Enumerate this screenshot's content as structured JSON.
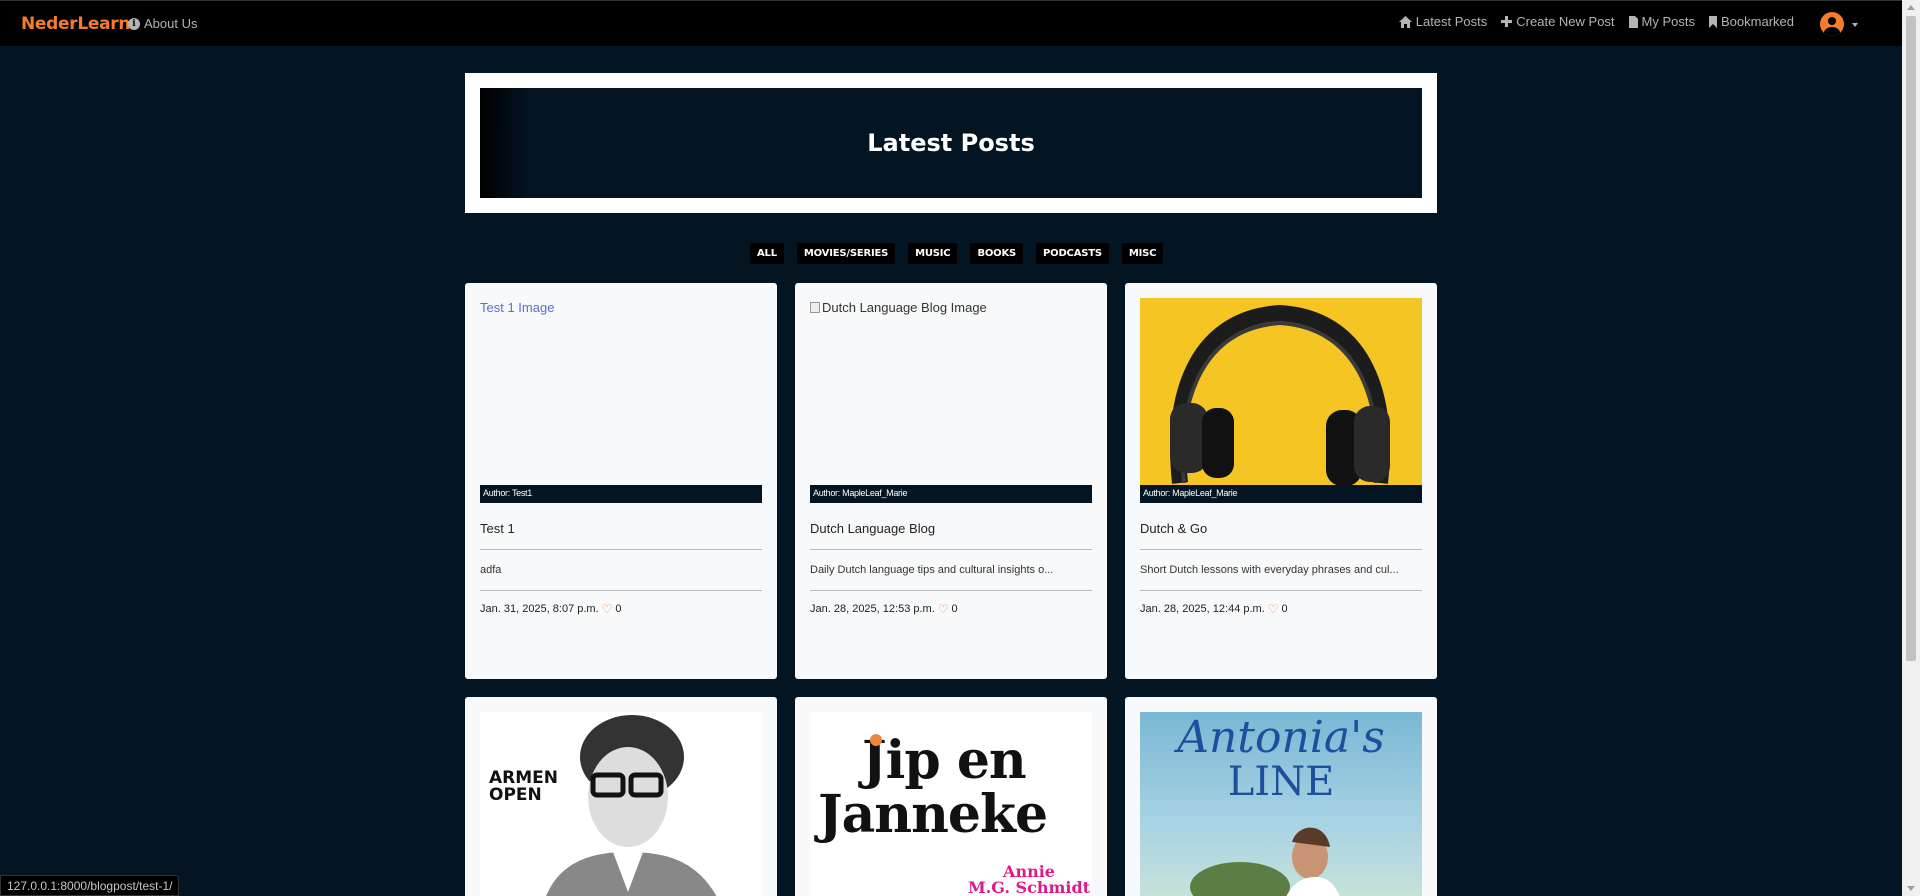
{
  "nav": {
    "brand": "NederLearn",
    "about": "About Us",
    "links": [
      "Latest Posts",
      "Create New Post",
      "My Posts",
      "Bookmarked"
    ]
  },
  "hero": {
    "title": "Latest Posts"
  },
  "filters": [
    "ALL",
    "MOVIES/SERIES",
    "MUSIC",
    "BOOKS",
    "PODCASTS",
    "MISC"
  ],
  "posts": [
    {
      "image_alt": "Test 1 Image",
      "author": "Author: Test1",
      "title": "Test 1",
      "description": "adfa",
      "date": "Jan. 31, 2025, 8:07 p.m.",
      "likes": "0"
    },
    {
      "image_alt": "Dutch Language Blog Image",
      "author": "Author: MapleLeaf_Marie",
      "title": "Dutch Language Blog",
      "description": "Daily Dutch language tips and cultural insights o...",
      "date": "Jan. 28, 2025, 12:53 p.m.",
      "likes": "0"
    },
    {
      "image_alt": "",
      "author": "Author: MapleLeaf_Marie",
      "title": "Dutch & Go",
      "description": "Short Dutch lessons with everyday phrases and cul...",
      "date": "Jan. 28, 2025, 12:44 p.m.",
      "likes": "0"
    }
  ],
  "row2": {
    "armen": [
      "ARMEN",
      "OPEN"
    ],
    "jip": [
      "Jip en",
      "Janneke",
      "Annie",
      "M.G. Schmidt"
    ],
    "antonia": [
      "Antonia's",
      "LINE"
    ]
  },
  "colors": {
    "accent": "#f47c2b",
    "page_bg": "#031423",
    "navbar_bg": "#000000",
    "card_bg": "#f8f9fa"
  },
  "status_url": "127.0.0.1:8000/blogpost/test-1/"
}
